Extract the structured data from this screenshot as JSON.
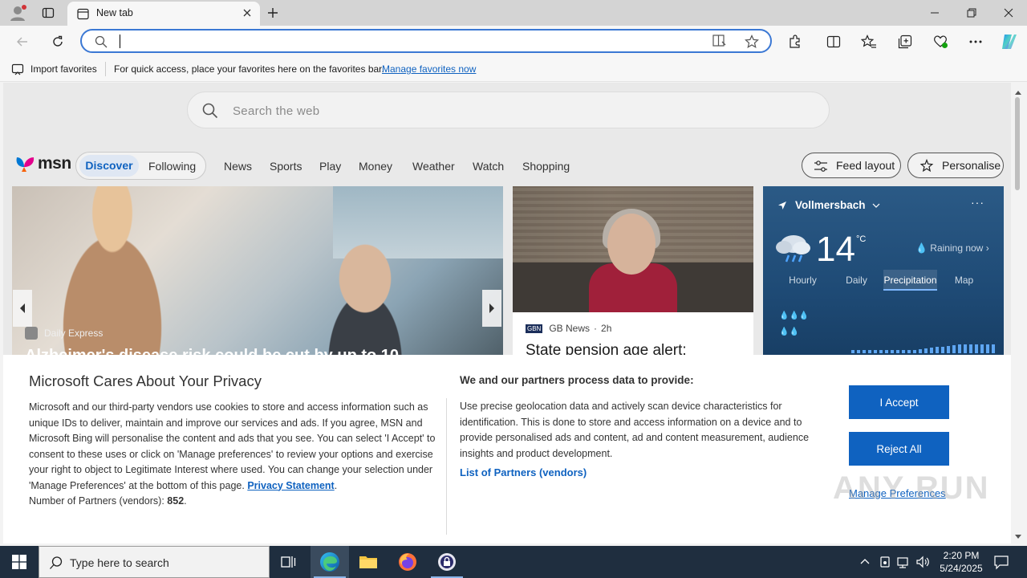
{
  "browser": {
    "tab_title": "New tab",
    "address_value": "",
    "favbar": {
      "import_label": "Import favorites",
      "message": "For quick access, place your favorites here on the favorites bar.",
      "manage_link": "Manage favorites now"
    }
  },
  "page": {
    "search_placeholder": "Search the web",
    "logo_text": "msn",
    "segment": {
      "discover": "Discover",
      "following": "Following"
    },
    "nav": [
      "News",
      "Sports",
      "Play",
      "Money",
      "Weather",
      "Watch",
      "Shopping"
    ],
    "feed_layout_label": "Feed layout",
    "personalise_label": "Personalise",
    "hero": {
      "source": "Daily Express",
      "headline": "Alzheimer's disease risk could be cut by up to 10"
    },
    "news": {
      "source": "GB News",
      "time": "2h",
      "headline": "State pension age alert:"
    },
    "weather": {
      "location": "Vollmersbach",
      "temperature": "14",
      "unit": "°C",
      "condition": "Raining now",
      "tabs": [
        "Hourly",
        "Daily",
        "Precipitation",
        "Map"
      ],
      "active_tab": "Precipitation",
      "precip_bar_levels": [
        0.3,
        0.3,
        0.3,
        0.3,
        0.3,
        0.3,
        0.3,
        0.3,
        0.3,
        0.3,
        0.3,
        0.3,
        0.35,
        0.4,
        0.5,
        0.55,
        0.6,
        0.65,
        0.7,
        0.75,
        0.8,
        0.8,
        0.8,
        0.8,
        0.8,
        0.8
      ]
    }
  },
  "privacy": {
    "title": "Microsoft Cares About Your Privacy",
    "body": "Microsoft and our third-party vendors use cookies to store and access information such as unique IDs to deliver, maintain and improve our services and ads. If you agree, MSN and Microsoft Bing will personalise the content and ads that you see. You can select 'I Accept' to consent to these uses or click on 'Manage preferences' to review your options and exercise your right to object to Legitimate Interest where used.  You can change your selection under 'Manage Preferences' at the bottom of this page.",
    "privacy_link": "Privacy Statement",
    "partners_count_label": "Number of Partners (vendors):",
    "partners_count": "852",
    "purpose_title": "We and our partners process data to provide:",
    "purpose_text": "Use precise geolocation data and actively scan device characteristics for identification. This is done to store and access information on a device and to provide personalised ads and content, ad and content measurement, audience insights and product development.",
    "partners_link": "List of Partners (vendors)",
    "accept_label": "I Accept",
    "reject_label": "Reject All",
    "manage_label": "Manage Preferences"
  },
  "watermark": "ANY RUN",
  "taskbar": {
    "search_placeholder": "Type here to search",
    "time": "2:20 PM",
    "date": "5/24/2025"
  },
  "colors": {
    "accent": "#0f62c0",
    "taskbar": "#1f2e3f",
    "address_border": "#3b78d4"
  }
}
